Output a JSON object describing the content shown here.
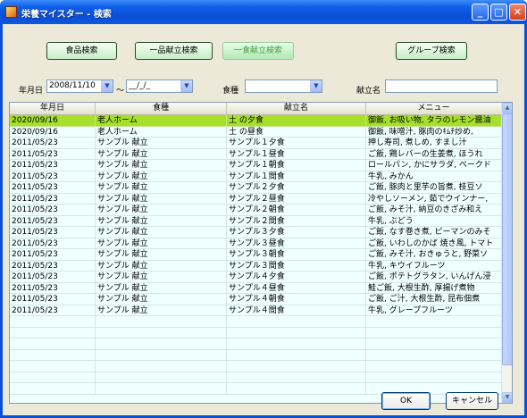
{
  "window": {
    "title": "栄養マイスター - 検索",
    "controls": {
      "minimize": "_",
      "maximize": "□",
      "close": "✕"
    }
  },
  "toolbar": {
    "food_search": "食品検索",
    "dish_search": "一品献立検索",
    "meal_search": "一食献立検索",
    "group_search": "グループ検索"
  },
  "filters": {
    "date_label": "年月日",
    "date_from": "2008/11/10",
    "date_sep": "～",
    "date_to": "__/_/_",
    "meal_type_label": "食種",
    "meal_type_value": "",
    "menu_name_label": "献立名",
    "menu_name_value": ""
  },
  "grid": {
    "columns": [
      "年月日",
      "食種",
      "献立名",
      "メニュー"
    ],
    "rows": [
      [
        "2020/09/16",
        "老人ホーム",
        "土 の夕食",
        "御飯, お吸い物, タラのレモン醤油"
      ],
      [
        "2020/09/16",
        "老人ホーム",
        "土 の昼食",
        "御飯, 味噌汁, 豚肉のｷﾑﾁ炒め,"
      ],
      [
        "2011/05/23",
        "サンプル 献立",
        "サンプル１夕食",
        "押し寿司, 煮しめ, すまし汁"
      ],
      [
        "2011/05/23",
        "サンプル 献立",
        "サンプル１昼食",
        "ご飯, 鶏レバーの生姜煮, ほうれ"
      ],
      [
        "2011/05/23",
        "サンプル 献立",
        "サンプル１朝食",
        "ロールパン, かにサラダ, ベークド"
      ],
      [
        "2011/05/23",
        "サンプル 献立",
        "サンプル１間食",
        "牛乳, みかん"
      ],
      [
        "2011/05/23",
        "サンプル 献立",
        "サンプル２夕食",
        "ご飯, 豚肉と里芋の旨煮, 枝豆ソ"
      ],
      [
        "2011/05/23",
        "サンプル 献立",
        "サンプル２昼食",
        "冷やしソーメン, 茹でウインナー,"
      ],
      [
        "2011/05/23",
        "サンプル 献立",
        "サンプル２朝食",
        "ご飯, みそ汁, 納豆のきざみ和え"
      ],
      [
        "2011/05/23",
        "サンプル 献立",
        "サンプル２間食",
        "牛乳, ぶどう"
      ],
      [
        "2011/05/23",
        "サンプル 献立",
        "サンプル３夕食",
        "ご飯, なす巻き煮, ピーマンのみそ"
      ],
      [
        "2011/05/23",
        "サンプル 献立",
        "サンプル３昼食",
        "ご飯, いわしのかば 焼き風, トマト"
      ],
      [
        "2011/05/23",
        "サンプル 献立",
        "サンプル３朝食",
        "ご飯, みそ汁, おきゅうと, 野菜ソ"
      ],
      [
        "2011/05/23",
        "サンプル 献立",
        "サンプル３間食",
        "牛乳, キウイフルーツ"
      ],
      [
        "2011/05/23",
        "サンプル 献立",
        "サンプル４夕食",
        "ご飯, ポテトグラタン, いんげん浸"
      ],
      [
        "2011/05/23",
        "サンプル 献立",
        "サンプル４昼食",
        "鮭ご飯, 大根生酢, 厚揚げ煮物"
      ],
      [
        "2011/05/23",
        "サンプル 献立",
        "サンプル４朝食",
        "ご飯, ご汁, 大根生酢, 昆布佃煮"
      ],
      [
        "2011/05/23",
        "サンプル 献立",
        "サンプル４間食",
        "牛乳, グレープフルーツ"
      ]
    ],
    "selected_row": 0
  },
  "footer": {
    "ok": "OK",
    "cancel": "キャンセル"
  },
  "colors": {
    "selected_row": "#a6e02a",
    "grid_bg": "#f0ffff",
    "header_bg": "#e3e0cd"
  }
}
